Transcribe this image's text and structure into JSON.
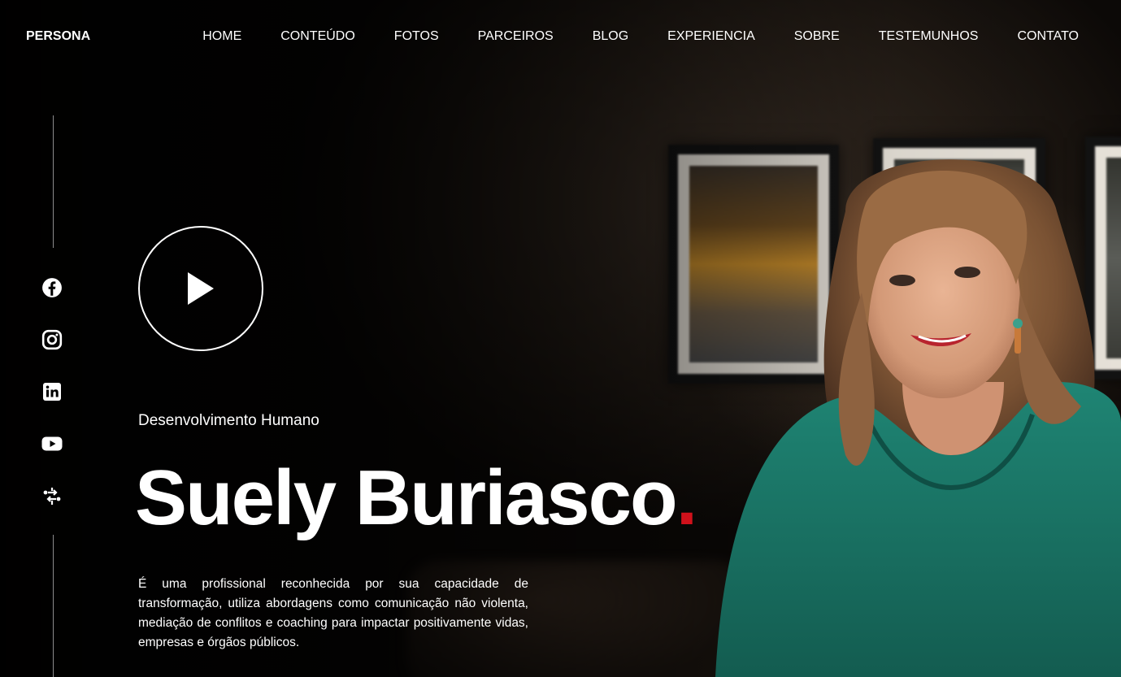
{
  "brand": "PERSONA",
  "nav": {
    "items": [
      {
        "label": "HOME"
      },
      {
        "label": "CONTEÚDO"
      },
      {
        "label": "FOTOS"
      },
      {
        "label": "PARCEIROS"
      },
      {
        "label": "BLOG"
      },
      {
        "label": "EXPERIENCIA"
      },
      {
        "label": "SOBRE"
      },
      {
        "label": "TESTEMUNHOS"
      },
      {
        "label": "CONTATO"
      }
    ]
  },
  "social": [
    {
      "icon": "facebook-icon"
    },
    {
      "icon": "instagram-icon"
    },
    {
      "icon": "linkedin-icon"
    },
    {
      "icon": "youtube-icon"
    },
    {
      "icon": "linktree-icon"
    }
  ],
  "hero": {
    "subtitle": "Desenvolvimento Humano",
    "name": "Suely Buriasco",
    "name_dot": ".",
    "description": "É uma profissional reconhecida por sua capacidade de transformação, utiliza abordagens como comunicação não violenta, mediação de conflitos e coaching para impactar positivamente vidas, empresas e órgãos públicos."
  },
  "colors": {
    "accent": "#d0111b",
    "text": "#ffffff",
    "background": "#000000",
    "blouse": "#1f7a6b"
  }
}
